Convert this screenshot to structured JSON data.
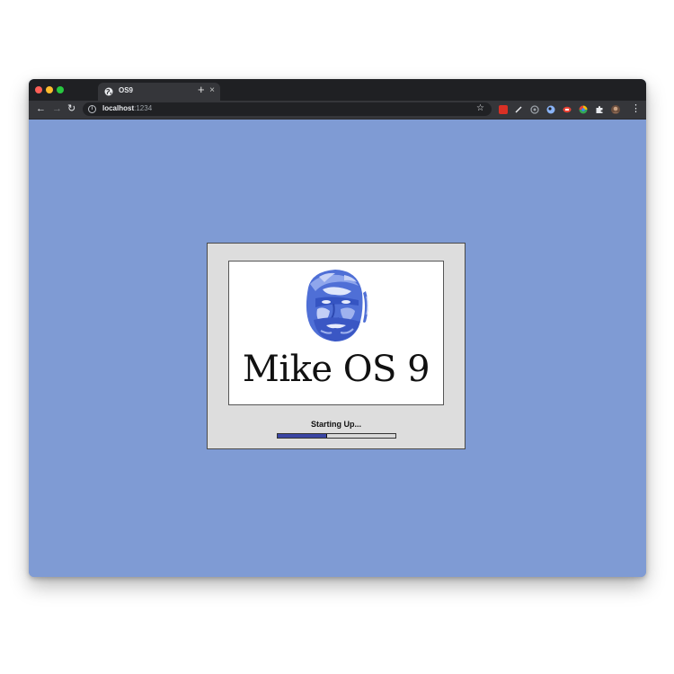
{
  "browser": {
    "tab": {
      "title": "OS9",
      "favicon": "globe-icon",
      "close_symbol": "×"
    },
    "new_tab_symbol": "+",
    "nav": {
      "back_symbol": "←",
      "forward_symbol": "→",
      "reload_symbol": "↻"
    },
    "address": {
      "host": "localhost",
      "port": ":1234"
    },
    "bookmark_symbol": "☆",
    "menu_symbol": "⋮",
    "extensions": [
      {
        "name": "red-square-extension-icon",
        "color": "#d93025"
      },
      {
        "name": "pen-extension-icon",
        "color": "#e8eaed"
      },
      {
        "name": "circle-extension-icon",
        "color": "#9aa0a6"
      },
      {
        "name": "blue-extension-icon",
        "color": "#8ab4f8"
      },
      {
        "name": "red-oval-extension-icon",
        "color": "#ea4335"
      },
      {
        "name": "chrome-extension-icon",
        "color": "#fbbc04"
      },
      {
        "name": "puzzle-extension-icon",
        "color": "#e8eaed"
      },
      {
        "name": "profile-avatar-icon",
        "color": "#b08a6a"
      }
    ]
  },
  "desktop": {
    "background_color": "#7f9bd4"
  },
  "startup": {
    "brand_title": "Mike OS 9",
    "portrait_icon": "face-portrait-icon",
    "status_text": "Starting Up...",
    "progress": 0.42,
    "progress_color": "#3a45a3"
  }
}
